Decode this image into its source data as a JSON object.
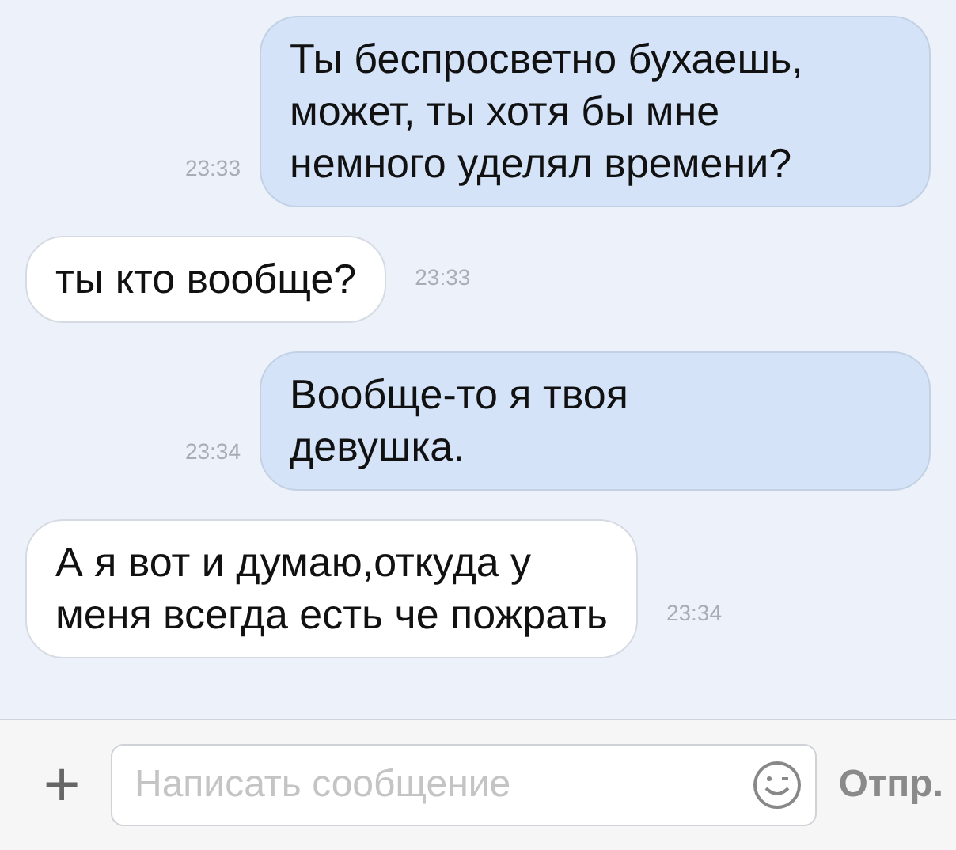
{
  "messages": [
    {
      "kind": "outgoing",
      "text": "Ты беспросветно бухаешь,\nможет, ты хотя бы мне\nнемного уделял времени?",
      "time": "23:33"
    },
    {
      "kind": "incoming",
      "text": "ты кто вообще?",
      "time": "23:33"
    },
    {
      "kind": "outgoing",
      "text": "Вообще-то я твоя\nдевушка.",
      "time": "23:34"
    },
    {
      "kind": "incoming",
      "text": "А я вот и думаю,откуда у\nменя всегда есть че пожрать",
      "time": "23:34"
    }
  ],
  "composer": {
    "add": "+",
    "placeholder": "Написать сообщение",
    "send": "Отпр."
  }
}
